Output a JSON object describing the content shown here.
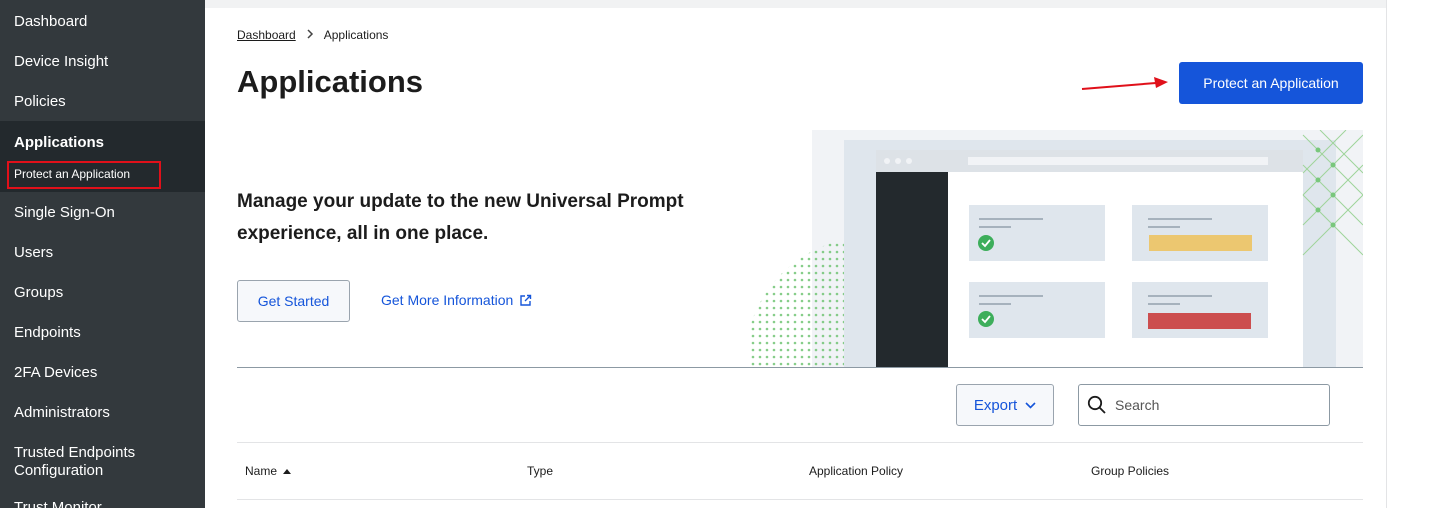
{
  "sidebar": {
    "items": [
      {
        "label": "Dashboard"
      },
      {
        "label": "Device Insight"
      },
      {
        "label": "Policies"
      },
      {
        "label": "Applications"
      },
      {
        "label": "Single Sign-On"
      },
      {
        "label": "Users"
      },
      {
        "label": "Groups"
      },
      {
        "label": "Endpoints"
      },
      {
        "label": "2FA Devices"
      },
      {
        "label": "Administrators"
      },
      {
        "label": "Trusted Endpoints Configuration"
      },
      {
        "label": "Trust Monitor"
      }
    ],
    "active_sub_item": "Protect an Application"
  },
  "breadcrumb": {
    "parent": "Dashboard",
    "current": "Applications"
  },
  "header": {
    "title": "Applications",
    "primary_button": "Protect an Application"
  },
  "banner": {
    "heading": "Manage your update to the new Universal Prompt experience, all in one place.",
    "get_started": "Get Started",
    "more_info": "Get More Information",
    "colors": {
      "success": "#3dae5b",
      "warning": "#ecc770",
      "error": "#cc4e4f"
    }
  },
  "toolbar": {
    "export_label": "Export",
    "search_placeholder": "Search"
  },
  "table": {
    "columns": [
      "Name",
      "Type",
      "Application Policy",
      "Group Policies"
    ],
    "sorted_column": "Name",
    "sort_direction": "ascending"
  },
  "colors": {
    "sidebar_bg": "#33393d",
    "primary": "#1555da",
    "highlight_box": "#e0101a"
  }
}
